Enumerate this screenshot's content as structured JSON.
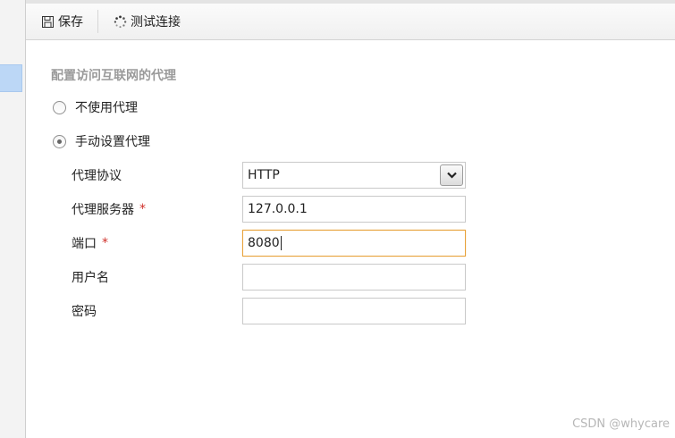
{
  "toolbar": {
    "save_label": "保存",
    "test_label": "测试连接",
    "save_icon": "floppy-disk-icon",
    "test_icon": "spinner-icon"
  },
  "section": {
    "title": "配置访问互联网的代理"
  },
  "options": {
    "no_proxy": {
      "label": "不使用代理",
      "checked": false
    },
    "manual_proxy": {
      "label": "手动设置代理",
      "checked": true
    }
  },
  "fields": {
    "protocol": {
      "label": "代理协议",
      "value": "HTTP"
    },
    "server": {
      "label": "代理服务器",
      "required_mark": "*",
      "value": "127.0.0.1"
    },
    "port": {
      "label": "端口",
      "required_mark": "*",
      "value": "8080"
    },
    "username": {
      "label": "用户名",
      "value": ""
    },
    "password": {
      "label": "密码",
      "value": ""
    }
  },
  "watermark": "CSDN @whycare",
  "colors": {
    "required": "#d0302a",
    "focus_border": "#e8a33c",
    "selected_sidebar": "#bcd7f6"
  }
}
